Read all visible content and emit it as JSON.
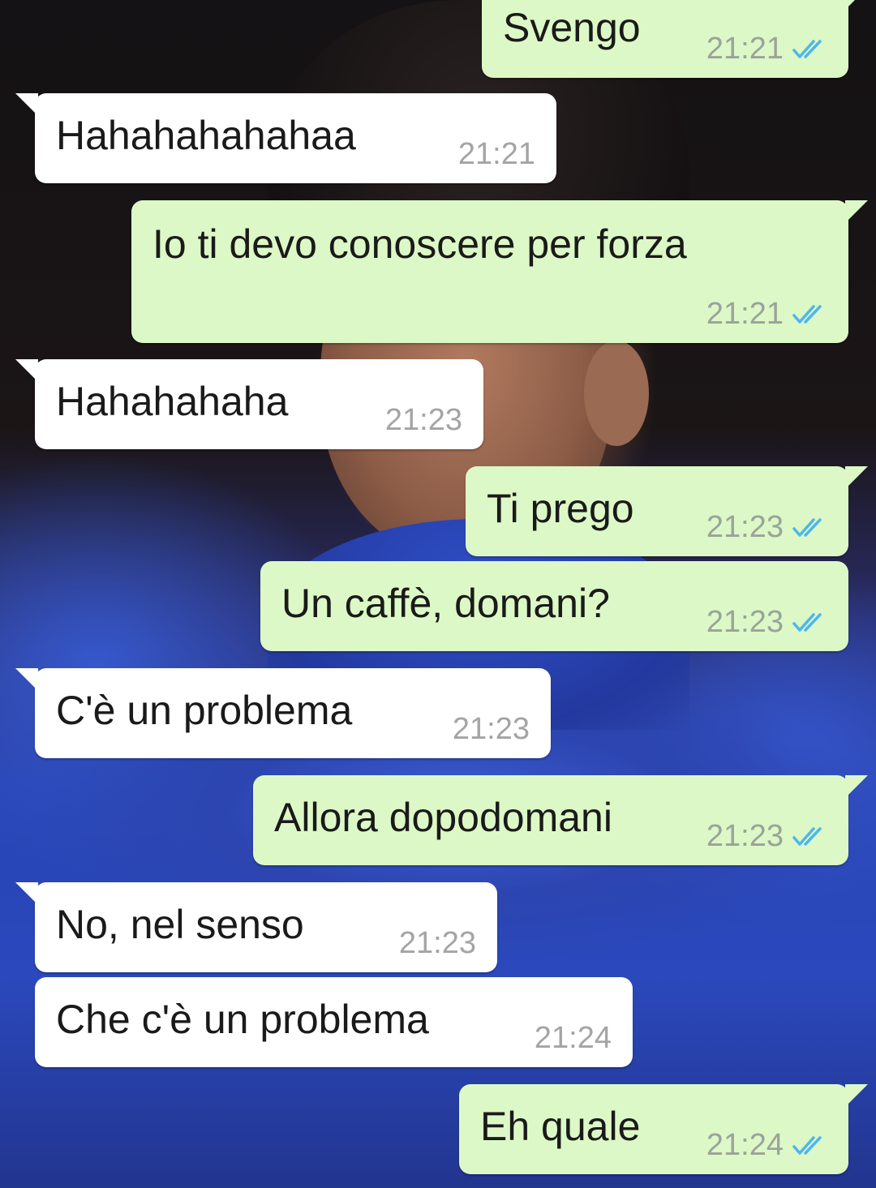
{
  "chat": {
    "messages": [
      {
        "direction": "out",
        "text": "Svengo",
        "time": "21:21",
        "status": "read"
      },
      {
        "direction": "in",
        "text": "Hahahahahahaa",
        "time": "21:21"
      },
      {
        "direction": "out",
        "text": "Io ti devo conoscere per forza",
        "time": "21:21",
        "status": "read"
      },
      {
        "direction": "in",
        "text": "Hahahahaha",
        "time": "21:23"
      },
      {
        "direction": "out",
        "text": "Ti prego",
        "time": "21:23",
        "status": "read"
      },
      {
        "direction": "out",
        "text": "Un caffè, domani?",
        "time": "21:23",
        "status": "read"
      },
      {
        "direction": "in",
        "text": "C'è un problema",
        "time": "21:23"
      },
      {
        "direction": "out",
        "text": "Allora dopodomani",
        "time": "21:23",
        "status": "read"
      },
      {
        "direction": "in",
        "text": "No, nel senso",
        "time": "21:23"
      },
      {
        "direction": "in",
        "text": "Che c'è un problema",
        "time": "21:24"
      },
      {
        "direction": "out",
        "text": "Eh quale",
        "time": "21:24",
        "status": "read"
      }
    ]
  },
  "colors": {
    "incoming_bubble": "#ffffff",
    "outgoing_bubble": "#dcf8c6",
    "read_ticks": "#4fb6ec",
    "timestamp": "#9aa39a"
  },
  "icons": {
    "read_status": "double-check-icon"
  }
}
